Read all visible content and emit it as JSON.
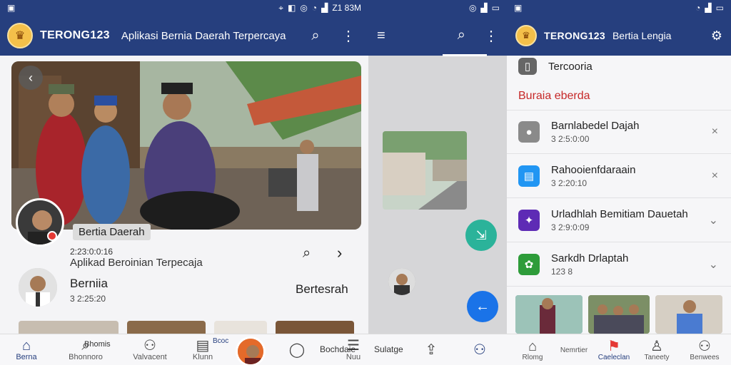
{
  "status_left": {
    "time": "Z1 83M"
  },
  "status_left_icons": [
    "sim-icon",
    "location-icon",
    "nfc-icon",
    "alarm-icon",
    "wifi-icon",
    "signal-icon"
  ],
  "status_right_icons": [
    "wifi-icon",
    "signal-icon",
    "battery-icon"
  ],
  "app": {
    "brand": "TERONG123",
    "tagline": "Aplikasi Bernia Daerah Terpercaya",
    "brand_right": "TERONG123",
    "tagline_right": "Bertia Lengia"
  },
  "profile": {
    "name_chip": "Bertia Daerah",
    "date": "2:23:0:0:16",
    "subtitle": "Aplikad Beroinian Terpecaja"
  },
  "card": {
    "title": "Berniia",
    "meta": "3 2:25:20",
    "right": "Bertesrah"
  },
  "bottom_nav": [
    {
      "label": "Berna",
      "icon": "home-icon",
      "active": true
    },
    {
      "label": "Bhonnoro",
      "icon": "search-icon"
    },
    {
      "label": "Valvacent",
      "icon": "user-icon"
    },
    {
      "label": "Klunn",
      "icon": "doc-icon"
    },
    {
      "label": "Bochdaie",
      "icon": "chat-icon"
    },
    {
      "label": "Nuu",
      "icon": "message-icon"
    },
    {
      "label": "",
      "icon": "share-icon"
    },
    {
      "label": "",
      "icon": "profile-icon",
      "active": true
    }
  ],
  "bottom_nav_tiny": {
    "klunn_top": "Bcoc",
    "search_label": "Bhomis",
    "chat_label": "Bochdaie",
    "nuu_label": "Sulatge"
  },
  "right_panel": {
    "first_item": "Tercooria",
    "section": "Buraia eberda",
    "items": [
      {
        "title": "Barnlabedel Dajah",
        "meta": "3 2:5:0:00",
        "color": "#8a8a8a"
      },
      {
        "title": "Rahooienfdaraain",
        "meta": "3 2:20:10",
        "color": "#2196f3"
      },
      {
        "title": "Urladhlah Bemitiam Dauetah",
        "meta": "3 2:9:0:09",
        "color": "#5e2bb5"
      },
      {
        "title": "Sarkdh Drlaptah",
        "meta": "123 8",
        "color": "#2e9c3a"
      }
    ],
    "nav": [
      {
        "label": "Rlomg",
        "icon": "home-icon"
      },
      {
        "label": "Nemrtier",
        "icon": "news-icon"
      },
      {
        "label": "Caeleclan",
        "icon": "flag-icon",
        "active": true
      },
      {
        "label": "Taneety",
        "icon": "person-icon"
      },
      {
        "label": "Benwees",
        "icon": "account-icon"
      }
    ]
  },
  "colors": {
    "appbar": "#263f7e",
    "accent": "#1a73e8",
    "fab_green": "#2bb39a",
    "red": "#c62828"
  }
}
